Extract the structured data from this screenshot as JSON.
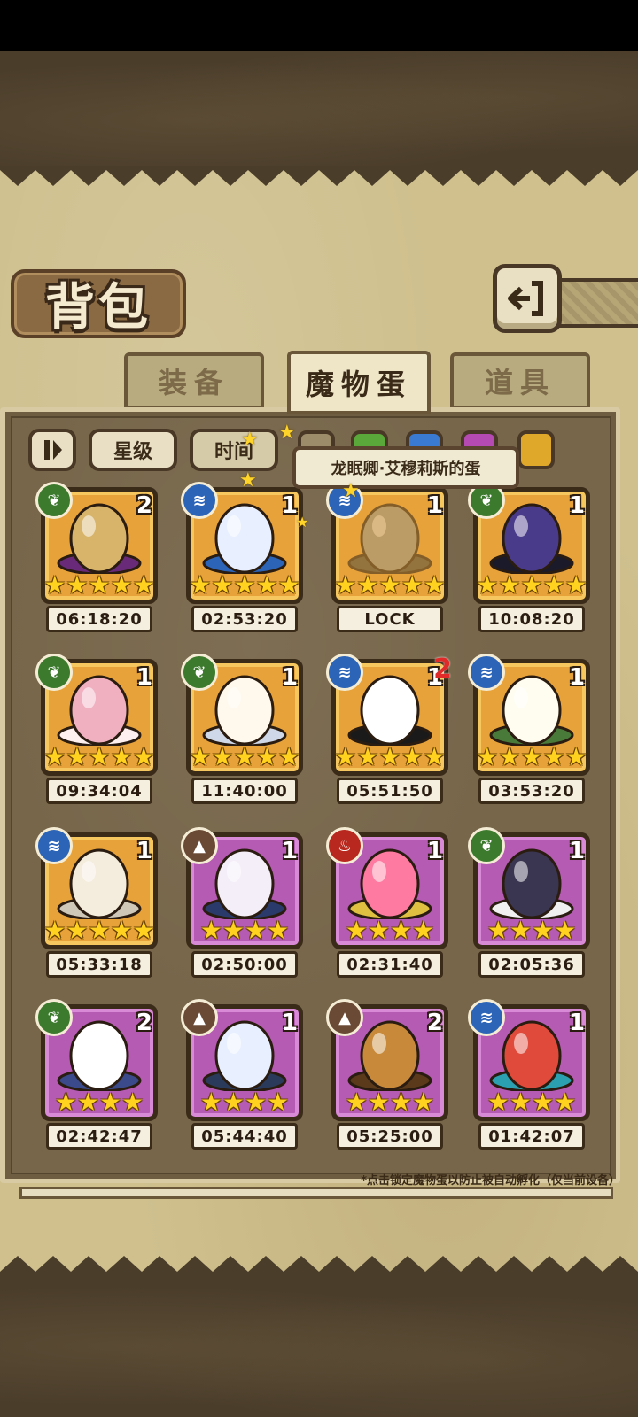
{
  "screen": {
    "title": "背包",
    "back_icon": "back-arrow-icon"
  },
  "tabs": [
    {
      "label": "装备",
      "active": false
    },
    {
      "label": "魔物蛋",
      "active": true
    },
    {
      "label": "道具",
      "active": false
    }
  ],
  "filters": {
    "sort_toggle_icon": "pause-sort-icon",
    "star_label": "星级",
    "time_label": "时间",
    "color_chips": [
      {
        "name": "neutral",
        "color": "#9c8c6a"
      },
      {
        "name": "green",
        "color": "#5aa83a"
      },
      {
        "name": "blue",
        "color": "#3a7ad0"
      },
      {
        "name": "purple",
        "color": "#b54ab3"
      },
      {
        "name": "gold",
        "color": "#e0a82a"
      }
    ]
  },
  "tooltip": {
    "text": "龙眠卿·艾穆莉斯的蛋"
  },
  "eggs": [
    {
      "element": "leaf",
      "count": "2",
      "stars": 5,
      "timer": "06:18:20",
      "rarity": "gold",
      "art": "lamp"
    },
    {
      "element": "water",
      "count": "1",
      "stars": 5,
      "timer": "02:53:20",
      "rarity": "gold",
      "art": "heart-egg"
    },
    {
      "element": "water",
      "count": "1",
      "stars": 5,
      "timer": "LOCK",
      "rarity": "gold",
      "art": "dragon-egg",
      "locked": true
    },
    {
      "element": "leaf",
      "count": "1",
      "stars": 5,
      "timer": "10:08:20",
      "rarity": "gold",
      "art": "purple-egg"
    },
    {
      "element": "leaf",
      "count": "1",
      "stars": 5,
      "timer": "09:34:04",
      "rarity": "gold",
      "art": "pink-egg"
    },
    {
      "element": "leaf",
      "count": "1",
      "stars": 5,
      "timer": "11:40:00",
      "rarity": "gold",
      "art": "angel-egg"
    },
    {
      "element": "water",
      "count": "1",
      "stars": 5,
      "timer": "05:51:50",
      "rarity": "gold",
      "art": "skull-egg",
      "note": "2"
    },
    {
      "element": "water",
      "count": "1",
      "stars": 5,
      "timer": "03:53:20",
      "rarity": "gold",
      "art": "vine-egg"
    },
    {
      "element": "water",
      "count": "1",
      "stars": 5,
      "timer": "05:33:18",
      "rarity": "gold",
      "art": "winged-egg"
    },
    {
      "element": "earth",
      "count": "1",
      "stars": 4,
      "timer": "02:50:00",
      "rarity": "purple",
      "art": "scroll-egg"
    },
    {
      "element": "fire",
      "count": "1",
      "stars": 4,
      "timer": "02:31:40",
      "rarity": "purple",
      "art": "crown-egg"
    },
    {
      "element": "leaf",
      "count": "1",
      "stars": 4,
      "timer": "02:05:36",
      "rarity": "purple",
      "art": "spiked-egg"
    },
    {
      "element": "leaf",
      "count": "2",
      "stars": 4,
      "timer": "02:42:47",
      "rarity": "purple",
      "art": "feather-egg"
    },
    {
      "element": "earth",
      "count": "1",
      "stars": 4,
      "timer": "05:44:40",
      "rarity": "purple",
      "art": "crystal-egg"
    },
    {
      "element": "earth",
      "count": "2",
      "stars": 4,
      "timer": "05:25:00",
      "rarity": "purple",
      "art": "fur-egg"
    },
    {
      "element": "water",
      "count": "1",
      "stars": 4,
      "timer": "01:42:07",
      "rarity": "purple",
      "art": "feather-crown-egg"
    }
  ],
  "footnote": "*点击锁定魔物蛋以防止被自动孵化（仅当前设备）"
}
